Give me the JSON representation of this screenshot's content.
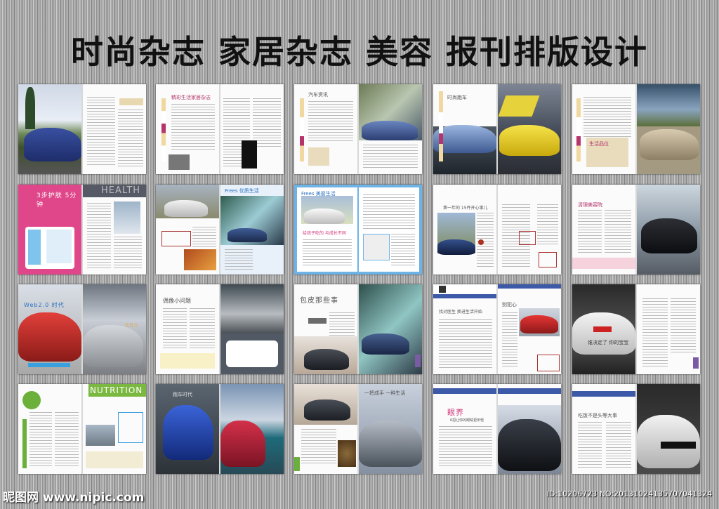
{
  "header": {
    "title": "时尚杂志 家居杂志 美容 报刊排版设计"
  },
  "spreads": [
    {
      "left_photo": "#3b4f85",
      "right_photo": "",
      "accent": "#c9a46a"
    },
    {
      "heading": "精彩生活家居杂志"
    },
    {
      "heading": "汽车资讯"
    },
    {
      "heading": "时尚跑车"
    },
    {
      "heading": "生活品位"
    },
    {
      "big": "3步护肤 5分钟",
      "word": "HEALTH"
    },
    {
      "heading": "Frees 优质生活"
    },
    {
      "heading": "Frees 美丽生活",
      "sub": "给孩子吃的 与成长不同"
    },
    {
      "heading": "第一年的 15件开心事儿"
    },
    {
      "heading": "清理美容院"
    },
    {
      "big": "Web2.0 时代",
      "word": "BBS"
    },
    {
      "heading": "偶像小问题"
    },
    {
      "big": "包皮那些事"
    },
    {
      "heading": "别犯心",
      "sub": "找对医生 换进生活开始"
    },
    {
      "heading": "谁决定了 你的宝宝"
    },
    {
      "word": "NUTRITION"
    },
    {
      "heading": "跑车时代"
    },
    {
      "heading": "一把成手 一种生活"
    },
    {
      "big": "眼养",
      "sub": "6招让你的眼睛更年轻"
    },
    {
      "heading": "吃饭不是头等大事"
    }
  ],
  "footer": {
    "left": "昵图网 www.nipic.com",
    "right": "ID:10206723 NO:20131024135707041324"
  }
}
